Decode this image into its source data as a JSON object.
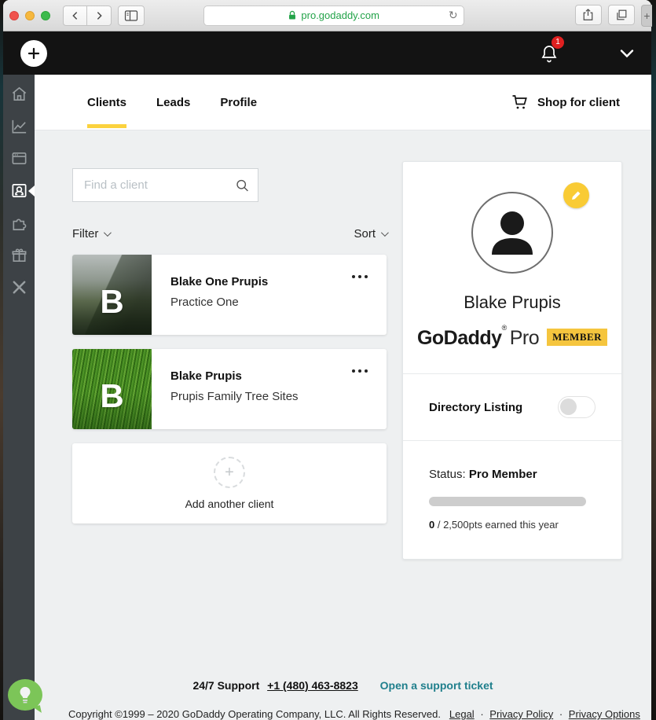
{
  "browser": {
    "url": "pro.godaddy.com",
    "new_tab_label": "+"
  },
  "app_header": {
    "notification_count": "1"
  },
  "sidebar": {
    "active": "clients",
    "icons": [
      "home",
      "analytics",
      "sites",
      "clients",
      "integrations",
      "rewards",
      "close",
      "feedback-lightbulb"
    ]
  },
  "nav": {
    "tabs": [
      {
        "label": "Clients",
        "active": true
      },
      {
        "label": "Leads",
        "active": false
      },
      {
        "label": "Profile",
        "active": false
      }
    ],
    "shop_label": "Shop for client"
  },
  "search": {
    "placeholder": "Find a client"
  },
  "list_controls": {
    "filter_label": "Filter",
    "sort_label": "Sort"
  },
  "clients": [
    {
      "initial": "B",
      "name": "Blake One Prupis",
      "subtitle": "Practice One"
    },
    {
      "initial": "B",
      "name": "Blake Prupis",
      "subtitle": "Prupis Family Tree Sites"
    }
  ],
  "add_client_label": "Add another client",
  "profile": {
    "name": "Blake Prupis",
    "brand": "GoDaddy",
    "brand_mark": "®",
    "brand_suffix": "Pro",
    "member_badge": "MEMBER",
    "directory_listing_label": "Directory Listing",
    "directory_listing_enabled": "false",
    "status_label": "Status:",
    "status_value": "Pro Member",
    "points_current": "0",
    "points_rest": " / 2,500pts earned this year",
    "progress_percent": 0
  },
  "support": {
    "prefix": "24/7 Support",
    "phone": "+1 (480) 463-8823",
    "ticket_label": "Open a support ticket"
  },
  "footer": {
    "copyright": "Copyright ©1999 – 2020 GoDaddy Operating Company, LLC. All Rights Reserved.",
    "links": [
      "Legal",
      "Privacy Policy",
      "Privacy Options"
    ],
    "separator": "·"
  },
  "colors": {
    "accent_gold": "#fbd23e",
    "teal_link": "#1f7f8c",
    "notification_red": "#e02020",
    "url_green": "#23a349",
    "sidebar_bg": "#3d4246",
    "header_bg": "#131313"
  }
}
